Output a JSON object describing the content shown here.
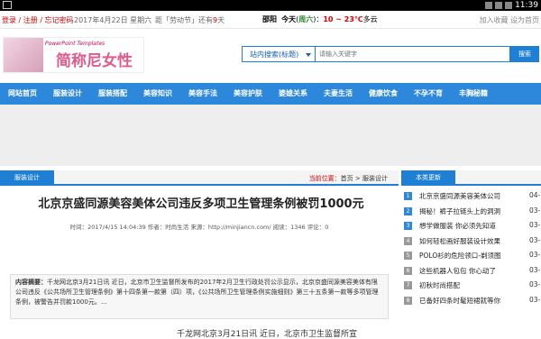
{
  "statusbar": {
    "time": "11:39"
  },
  "topbar": {
    "login": "登录 / 注册 / 忘记密码",
    "date": "2017年4月22日 星期六",
    "countdown_prefix": "距「劳动节」还有",
    "countdown_days": "9",
    "countdown_suffix": "天",
    "city": "邵阳",
    "today_label": "今天",
    "weather_desc": "周六",
    "temperature": "10 ~ 23℃",
    "weather_cond": "多云",
    "fav": "加入收藏  设为首页"
  },
  "logo": {
    "subtitle": "PowerPoint Templates",
    "name": "简称尼女性"
  },
  "search": {
    "scope": "站内搜索(标题)",
    "placeholder": "请输入关键字",
    "button": "搜索"
  },
  "nav": [
    "网站首页",
    "服装设计",
    "服装搭配",
    "美容知识",
    "美容手法",
    "美容护肤",
    "婆媳关系",
    "夫妻生活",
    "健康饮食",
    "不孕不育",
    "丰胸秘籍"
  ],
  "main": {
    "category": "服装设计",
    "crumb_here": "当前位置：",
    "crumb_path": "首页 > 服装设计",
    "title": "北京京盛同源美容美体公司违反多项卫生管理条例被罚1000元",
    "meta": "时间：2017/4/15 14:04:39   作者：时尚生活   来源：http://minjiancn.com/   阅读：1346   评论：0",
    "summary_label": "内容摘要：",
    "summary": "千龙网北京3月21日讯 近日，北京市卫生监督所发布的2017年2月卫生行政处罚公示显示，北京京盛同源美容美体有限公司违反《公共场所卫生管理条例》第十四条第一款第（四）项，《公共场所卫生管理条例实施细则》第三十五条第一款等多项管理条例，被警告并罚款1000元。...",
    "body_start": "千龙网北京3月21日讯 近日，北京市卫生监督所宣"
  },
  "sidebar": {
    "title": "本类更新",
    "items": [
      {
        "num": "1",
        "text": "北京京盛同源美容美体公司",
        "date": "04-"
      },
      {
        "num": "2",
        "text": "揭秘！裤子拉链头上的洞洞",
        "date": "03-"
      },
      {
        "num": "3",
        "text": "想学做服装 你必须先知道",
        "date": "03-"
      },
      {
        "num": "4",
        "text": "如何轻松画好服装设计效果",
        "date": "03-"
      },
      {
        "num": "5",
        "text": "POLO衫的危险领口-剃须图",
        "date": "03-"
      },
      {
        "num": "6",
        "text": "这些机器人包包 你心动了",
        "date": "03-"
      },
      {
        "num": "7",
        "text": "初秋时尚搭配",
        "date": "03-"
      },
      {
        "num": "8",
        "text": "已备好四条时髦短裙就等你",
        "date": "03-"
      }
    ]
  }
}
